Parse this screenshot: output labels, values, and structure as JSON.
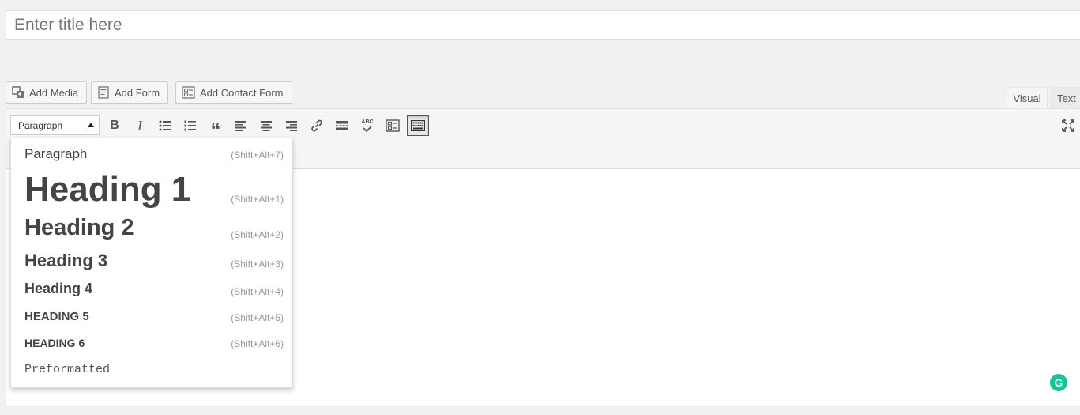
{
  "title_field": {
    "placeholder": "Enter title here"
  },
  "media_buttons": {
    "add_media": "Add Media",
    "add_form": "Add Form",
    "add_contact_form": "Add Contact Form"
  },
  "editor_tabs": {
    "visual": "Visual",
    "text": "Text",
    "active": "Visual"
  },
  "toolbar": {
    "format_select_value": "Paragraph",
    "buttons": [
      {
        "name": "bold-icon"
      },
      {
        "name": "italic-icon"
      },
      {
        "name": "bulleted-list-icon"
      },
      {
        "name": "numbered-list-icon"
      },
      {
        "name": "blockquote-icon"
      },
      {
        "name": "align-left-icon"
      },
      {
        "name": "align-center-icon"
      },
      {
        "name": "align-right-icon"
      },
      {
        "name": "link-icon"
      },
      {
        "name": "read-more-icon"
      },
      {
        "name": "spellcheck-icon"
      },
      {
        "name": "form-icon"
      },
      {
        "name": "toolbar-toggle-icon"
      }
    ],
    "spellcheck_glyph_text": "ABC"
  },
  "format_dropdown": {
    "items": [
      {
        "label": "Paragraph",
        "shortcut": "(Shift+Alt+7)"
      },
      {
        "label": "Heading 1",
        "shortcut": "(Shift+Alt+1)"
      },
      {
        "label": "Heading 2",
        "shortcut": "(Shift+Alt+2)"
      },
      {
        "label": "Heading 3",
        "shortcut": "(Shift+Alt+3)"
      },
      {
        "label": "Heading 4",
        "shortcut": "(Shift+Alt+4)"
      },
      {
        "label": "HEADING 5",
        "shortcut": "(Shift+Alt+5)"
      },
      {
        "label": "HEADING 6",
        "shortcut": "(Shift+Alt+6)"
      },
      {
        "label": "Preformatted",
        "shortcut": ""
      }
    ]
  },
  "grammarly": {
    "glyph": "G",
    "color": "#15c39a"
  }
}
